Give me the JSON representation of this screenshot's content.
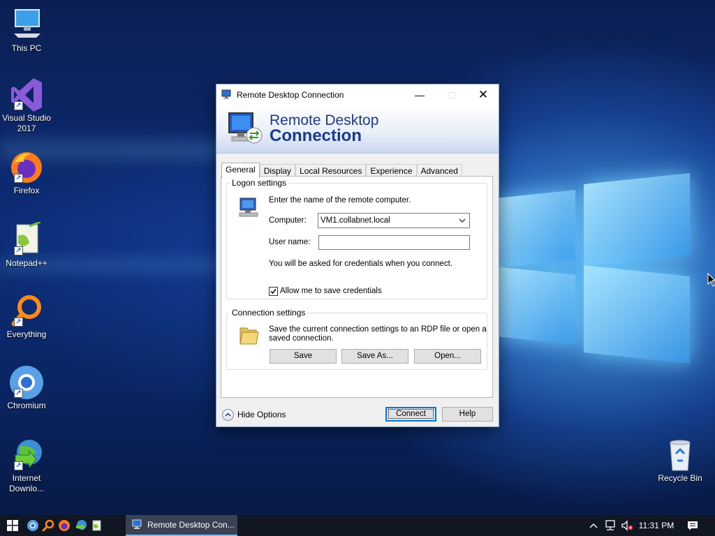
{
  "desktop": {
    "icons": [
      {
        "label": "This PC"
      },
      {
        "label": "Visual Studio 2017"
      },
      {
        "label": "Firefox"
      },
      {
        "label": "Notepad++"
      },
      {
        "label": "Everything"
      },
      {
        "label": "Chromium"
      },
      {
        "label": "Internet Downlo..."
      },
      {
        "label": "Recycle Bin"
      }
    ]
  },
  "dialog": {
    "title": "Remote Desktop Connection",
    "banner_line1": "Remote Desktop",
    "banner_line2": "Connection",
    "tabs": [
      {
        "label": "General",
        "active": true
      },
      {
        "label": "Display"
      },
      {
        "label": "Local Resources"
      },
      {
        "label": "Experience"
      },
      {
        "label": "Advanced"
      }
    ],
    "logon": {
      "legend": "Logon settings",
      "instruction": "Enter the name of the remote computer.",
      "computer_label": "Computer:",
      "computer_value": "VM1.collabnet.local",
      "username_label": "User name:",
      "username_value": "",
      "credentials_note": "You will be asked for credentials when you connect.",
      "save_credentials_label": "Allow me to save credentials",
      "save_credentials_checked": true
    },
    "connection": {
      "legend": "Connection settings",
      "text_line1": "Save the current connection settings to an RDP file or open a",
      "text_line2": "saved connection.",
      "save": "Save",
      "save_as": "Save As...",
      "open": "Open..."
    },
    "footer": {
      "hide_options": "Hide Options",
      "connect": "Connect",
      "help": "Help"
    }
  },
  "taskbar": {
    "active_window_label": "Remote Desktop Con...",
    "time": "11:31 PM"
  },
  "colors": {
    "accent": "#0078d7",
    "banner_text": "#1b3a8c",
    "taskbar": "#101622"
  }
}
